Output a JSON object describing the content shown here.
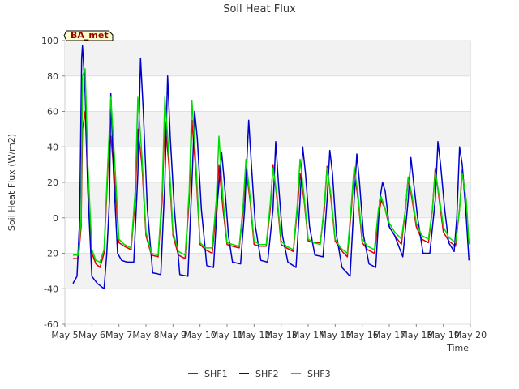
{
  "chart_data": {
    "type": "line",
    "title": "Soil Heat Flux",
    "xlabel": "Time",
    "ylabel": "Soil Heat Flux (W/m2)",
    "ylim": [
      -60,
      100
    ],
    "xlim": [
      5,
      20
    ],
    "yticks": [
      -60,
      -40,
      -20,
      0,
      20,
      40,
      60,
      80,
      100
    ],
    "xticks": [
      5,
      6,
      7,
      8,
      9,
      10,
      11,
      12,
      13,
      14,
      15,
      16,
      17,
      18,
      19,
      20
    ],
    "xtick_labels": [
      "May 5",
      "May 6",
      "May 7",
      "May 8",
      "May 9",
      "May 10",
      "May 11",
      "May 12",
      "May 13",
      "May 14",
      "May 15",
      "May 16",
      "May 17",
      "May 18",
      "May 19",
      "May 20"
    ],
    "grid": true,
    "legend_position": "bottom-center",
    "annotation": "BA_met",
    "series": [
      {
        "name": "SHF1",
        "color": "#dd0000",
        "x": [
          5.3,
          5.5,
          5.6,
          5.65,
          5.75,
          5.85,
          6.0,
          6.15,
          6.3,
          6.45,
          6.6,
          6.7,
          6.85,
          7.0,
          7.2,
          7.45,
          7.6,
          7.7,
          7.85,
          8.0,
          8.2,
          8.45,
          8.6,
          8.7,
          8.85,
          9.0,
          9.2,
          9.45,
          9.6,
          9.7,
          9.85,
          10.0,
          10.2,
          10.45,
          10.6,
          10.7,
          10.85,
          11.0,
          11.2,
          11.45,
          11.6,
          11.7,
          11.85,
          12.0,
          12.2,
          12.45,
          12.6,
          12.7,
          12.85,
          13.0,
          13.2,
          13.45,
          13.6,
          13.7,
          13.85,
          14.0,
          14.2,
          14.45,
          14.6,
          14.7,
          14.85,
          15.0,
          15.2,
          15.45,
          15.6,
          15.7,
          15.85,
          16.0,
          16.2,
          16.45,
          16.6,
          16.7,
          16.85,
          17.0,
          17.2,
          17.45,
          17.6,
          17.7,
          17.85,
          18.0,
          18.2,
          18.45,
          18.6,
          18.7,
          18.85,
          19.0,
          19.2,
          19.45,
          19.6,
          19.7,
          19.85,
          19.95
        ],
        "y": [
          -23,
          -23,
          -5,
          50,
          60,
          20,
          -20,
          -26,
          -28,
          -20,
          30,
          46,
          20,
          -14,
          -16,
          -18,
          10,
          50,
          30,
          -10,
          -21,
          -22,
          10,
          55,
          30,
          -10,
          -21,
          -23,
          10,
          55,
          25,
          -15,
          -18,
          -20,
          5,
          30,
          5,
          -15,
          -16,
          -17,
          5,
          28,
          10,
          -15,
          -16,
          -16,
          5,
          30,
          10,
          -15,
          -17,
          -19,
          5,
          25,
          10,
          -13,
          -14,
          -14,
          5,
          29,
          10,
          -13,
          -18,
          -22,
          5,
          27,
          10,
          -14,
          -18,
          -20,
          0,
          10,
          5,
          -5,
          -10,
          -15,
          5,
          22,
          10,
          -5,
          -12,
          -14,
          5,
          28,
          10,
          -8,
          -13,
          -16,
          5,
          27,
          8,
          -15
        ]
      },
      {
        "name": "SHF2",
        "color": "#0000cc",
        "x": [
          5.3,
          5.45,
          5.55,
          5.62,
          5.65,
          5.7,
          5.75,
          5.85,
          6.0,
          6.2,
          6.45,
          6.55,
          6.65,
          6.7,
          6.8,
          6.95,
          7.1,
          7.3,
          7.55,
          7.7,
          7.8,
          7.9,
          8.05,
          8.25,
          8.55,
          8.7,
          8.8,
          8.9,
          9.05,
          9.25,
          9.55,
          9.7,
          9.8,
          9.9,
          10.05,
          10.25,
          10.5,
          10.65,
          10.8,
          10.9,
          11.05,
          11.2,
          11.5,
          11.65,
          11.8,
          11.9,
          12.05,
          12.25,
          12.5,
          12.7,
          12.8,
          12.9,
          13.05,
          13.25,
          13.55,
          13.7,
          13.8,
          13.9,
          14.05,
          14.25,
          14.55,
          14.7,
          14.8,
          14.9,
          15.05,
          15.25,
          15.55,
          15.7,
          15.8,
          15.9,
          16.05,
          16.25,
          16.5,
          16.65,
          16.75,
          16.85,
          17.0,
          17.2,
          17.5,
          17.7,
          17.8,
          17.9,
          18.05,
          18.25,
          18.5,
          18.7,
          18.8,
          18.9,
          19.05,
          19.2,
          19.4,
          19.5,
          19.6,
          19.7,
          19.85,
          19.95
        ],
        "y": [
          -37,
          -33,
          0,
          90,
          97,
          85,
          70,
          15,
          -33,
          -37,
          -40,
          -20,
          10,
          70,
          25,
          -20,
          -24,
          -25,
          -25,
          25,
          90,
          60,
          5,
          -31,
          -32,
          20,
          80,
          45,
          5,
          -32,
          -33,
          20,
          60,
          45,
          5,
          -27,
          -28,
          10,
          37,
          20,
          -10,
          -25,
          -26,
          5,
          55,
          30,
          -5,
          -24,
          -25,
          5,
          43,
          20,
          -10,
          -25,
          -28,
          10,
          40,
          25,
          -5,
          -21,
          -22,
          10,
          38,
          25,
          -10,
          -28,
          -33,
          10,
          36,
          20,
          -10,
          -26,
          -28,
          10,
          20,
          15,
          -5,
          -10,
          -22,
          10,
          34,
          20,
          0,
          -20,
          -20,
          10,
          43,
          30,
          5,
          -14,
          -19,
          0,
          40,
          30,
          0,
          -24
        ]
      },
      {
        "name": "SHF3",
        "color": "#00dd00",
        "x": [
          5.3,
          5.5,
          5.6,
          5.65,
          5.75,
          5.85,
          6.0,
          6.15,
          6.3,
          6.45,
          6.6,
          6.7,
          6.85,
          7.0,
          7.2,
          7.45,
          7.6,
          7.7,
          7.85,
          8.0,
          8.2,
          8.45,
          8.6,
          8.7,
          8.85,
          9.0,
          9.2,
          9.45,
          9.6,
          9.7,
          9.85,
          10.0,
          10.2,
          10.45,
          10.6,
          10.7,
          10.85,
          11.0,
          11.2,
          11.45,
          11.6,
          11.7,
          11.85,
          12.0,
          12.2,
          12.45,
          12.6,
          12.7,
          12.85,
          13.0,
          13.2,
          13.45,
          13.6,
          13.7,
          13.85,
          14.0,
          14.2,
          14.45,
          14.6,
          14.7,
          14.85,
          15.0,
          15.2,
          15.45,
          15.6,
          15.7,
          15.85,
          16.0,
          16.2,
          16.45,
          16.6,
          16.7,
          16.85,
          17.0,
          17.2,
          17.45,
          17.6,
          17.7,
          17.85,
          18.0,
          18.2,
          18.45,
          18.6,
          18.7,
          18.85,
          19.0,
          19.2,
          19.45,
          19.6,
          19.7,
          19.85,
          19.95
        ],
        "y": [
          -21,
          -21,
          0,
          80,
          84,
          30,
          -18,
          -24,
          -25,
          -18,
          35,
          68,
          30,
          -12,
          -15,
          -17,
          15,
          68,
          35,
          -8,
          -20,
          -21,
          15,
          68,
          35,
          -8,
          -19,
          -21,
          15,
          66,
          30,
          -14,
          -17,
          -17,
          10,
          46,
          10,
          -14,
          -15,
          -16,
          8,
          33,
          12,
          -13,
          -15,
          -15,
          8,
          28,
          12,
          -13,
          -16,
          -18,
          8,
          33,
          12,
          -12,
          -14,
          -15,
          8,
          28,
          12,
          -12,
          -17,
          -20,
          8,
          29,
          12,
          -12,
          -16,
          -18,
          5,
          12,
          5,
          -3,
          -8,
          -12,
          5,
          23,
          12,
          -3,
          -10,
          -12,
          5,
          26,
          12,
          -5,
          -11,
          -14,
          5,
          25,
          10,
          -15
        ]
      }
    ]
  }
}
